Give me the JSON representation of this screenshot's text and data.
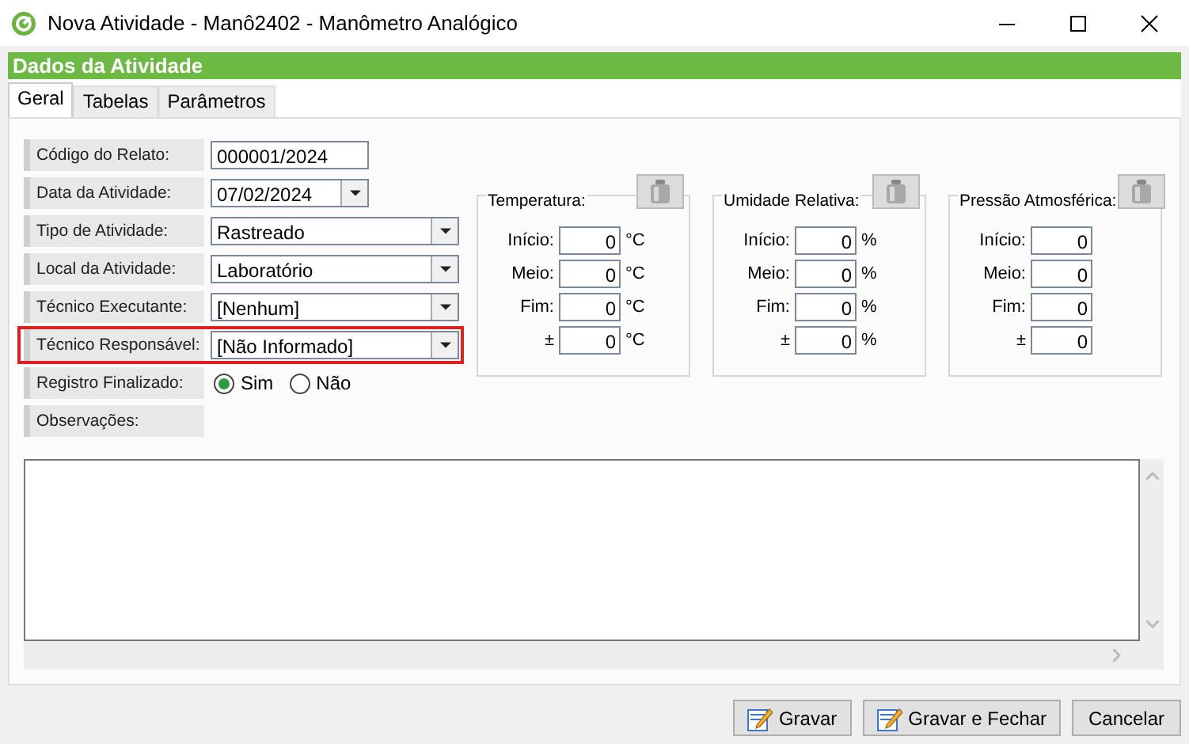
{
  "window": {
    "title": "Nova Atividade - Manô2402 - Manômetro Analógico"
  },
  "header": "Dados da Atividade",
  "tabs": [
    {
      "label": "Geral",
      "selected": true
    },
    {
      "label": "Tabelas",
      "selected": false
    },
    {
      "label": "Parâmetros",
      "selected": false
    }
  ],
  "fields": [
    {
      "label": "Código do Relato:",
      "kind": "text",
      "value": "000001/2024",
      "highlighted": false
    },
    {
      "label": "Data da Atividade:",
      "kind": "date",
      "value": "07/02/2024",
      "highlighted": false
    },
    {
      "label": "Tipo de Atividade:",
      "kind": "combo",
      "value": "Rastreado",
      "highlighted": false
    },
    {
      "label": "Local da Atividade:",
      "kind": "combo",
      "value": "Laboratório",
      "highlighted": false
    },
    {
      "label": "Técnico Executante:",
      "kind": "combo",
      "value": "[Nenhum]",
      "highlighted": false
    },
    {
      "label": "Técnico Responsável:",
      "kind": "combo",
      "value": "[Não Informado]",
      "highlighted": true
    },
    {
      "label": "Registro Finalizado:",
      "kind": "radio",
      "highlighted": false,
      "options": [
        {
          "label": "Sim",
          "selected": true
        },
        {
          "label": "Não",
          "selected": false
        }
      ]
    },
    {
      "label": "Observações:",
      "kind": "label",
      "highlighted": false
    }
  ],
  "groups": [
    {
      "title": "Temperatura:",
      "rows": [
        {
          "label": "Início:",
          "value": "0",
          "unit": "°C"
        },
        {
          "label": "Meio:",
          "value": "0",
          "unit": "°C"
        },
        {
          "label": "Fim:",
          "value": "0",
          "unit": "°C"
        },
        {
          "label": "±",
          "value": "0",
          "unit": "°C"
        }
      ]
    },
    {
      "title": "Umidade Relativa:",
      "rows": [
        {
          "label": "Início:",
          "value": "0",
          "unit": "%"
        },
        {
          "label": "Meio:",
          "value": "0",
          "unit": "%"
        },
        {
          "label": "Fim:",
          "value": "0",
          "unit": "%"
        },
        {
          "label": "±",
          "value": "0",
          "unit": "%"
        }
      ]
    },
    {
      "title": "Pressão Atmosférica:",
      "rows": [
        {
          "label": "Início:",
          "value": "0"
        },
        {
          "label": "Meio:",
          "value": "0"
        },
        {
          "label": "Fim:",
          "value": "0"
        },
        {
          "label": "±",
          "value": "0"
        }
      ]
    }
  ],
  "buttons": [
    {
      "label": "Gravar",
      "kind": "icon"
    },
    {
      "label": "Gravar e Fechar",
      "kind": "icon"
    },
    {
      "label": "Cancelar",
      "kind": "plain"
    }
  ]
}
